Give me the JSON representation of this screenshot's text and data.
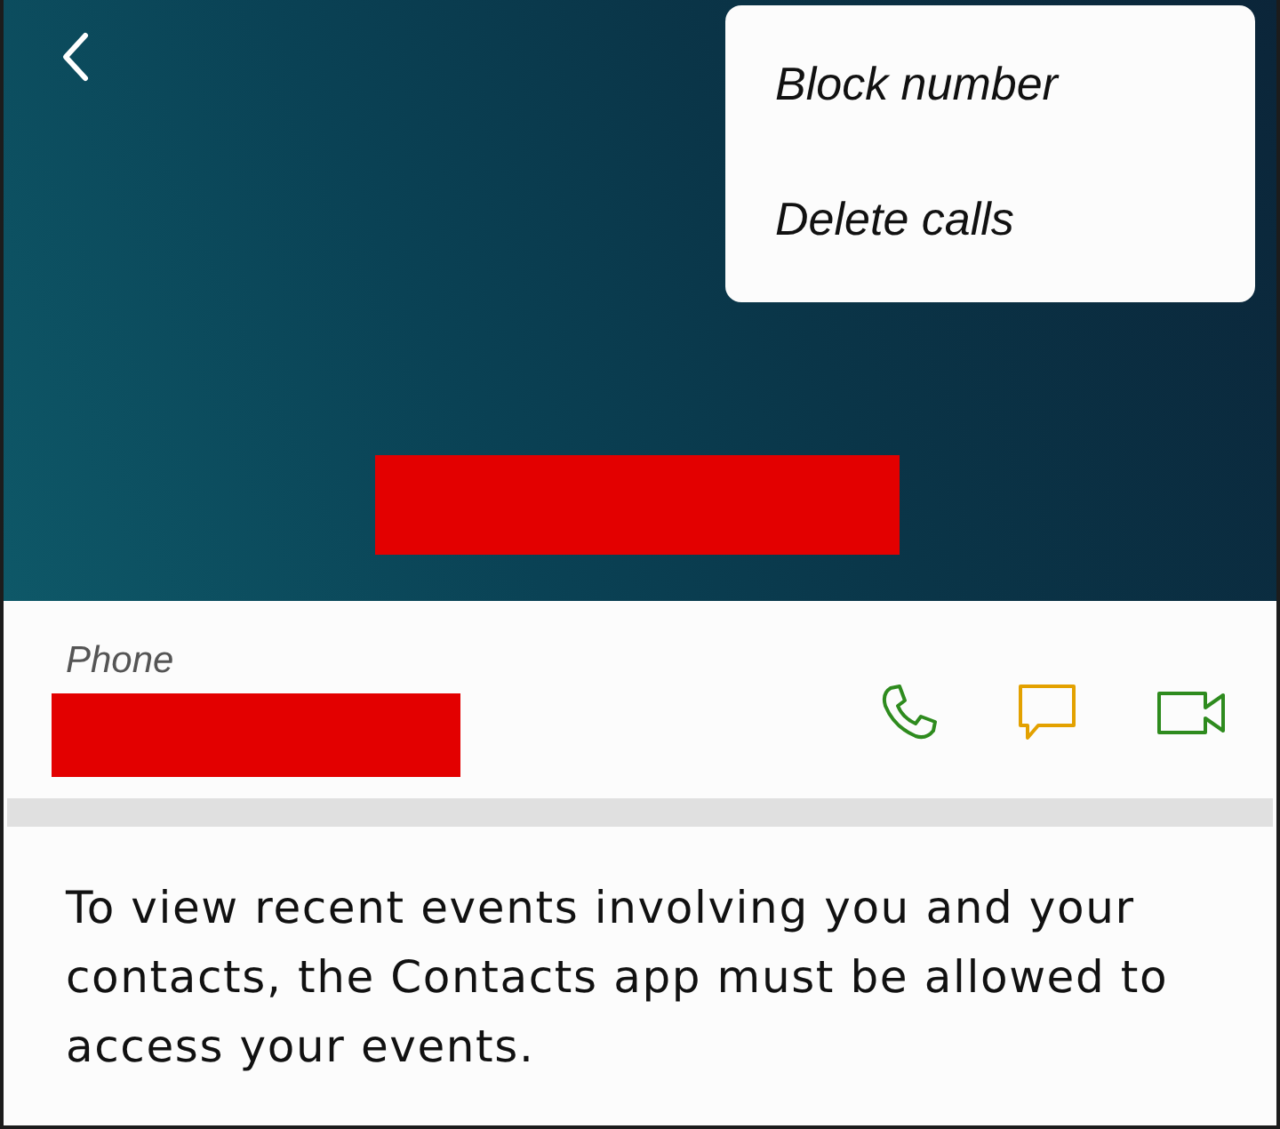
{
  "header": {
    "menu": [
      {
        "label": "Block number"
      },
      {
        "label": "Delete calls"
      }
    ]
  },
  "phone": {
    "label": "Phone",
    "actions": [
      {
        "kind": "call"
      },
      {
        "kind": "message"
      },
      {
        "kind": "video"
      }
    ]
  },
  "notice": "To view recent events involving you and your contacts, the Contacts app must be allowed to access your events."
}
